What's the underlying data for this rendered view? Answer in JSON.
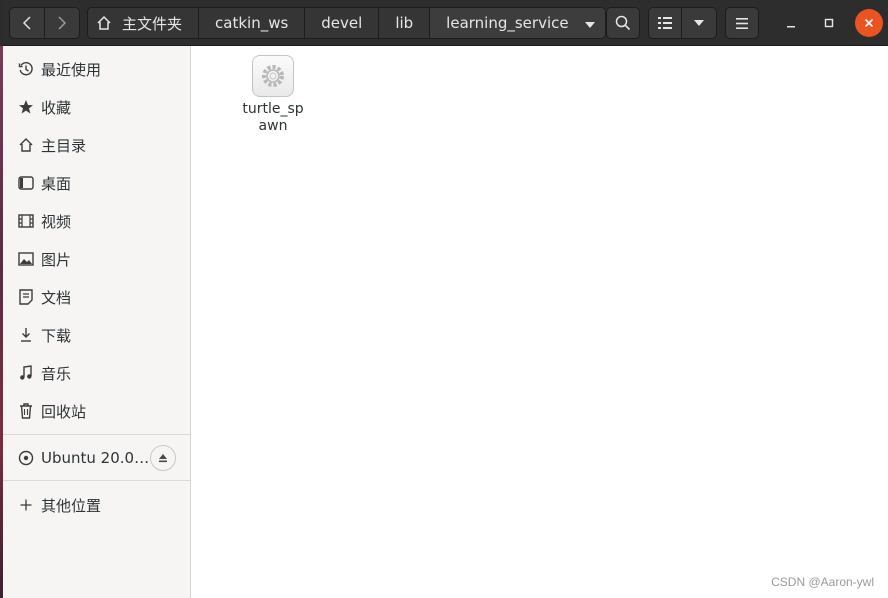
{
  "colors": {
    "accent_close": "#e95420",
    "headerbar_bg": "#2d2d2d",
    "sidebar_bg": "#f6f5f4",
    "content_bg": "#ffffff"
  },
  "header": {
    "back_icon": "chevron-left-icon",
    "forward_icon": "chevron-right-icon",
    "breadcrumbs": [
      "主文件夹",
      "catkin_ws",
      "devel",
      "lib",
      "learning_service"
    ],
    "search_icon": "search-icon",
    "view_icon": "list-view-icon",
    "view_menu_icon": "chevron-down-icon",
    "menu_icon": "hamburger-menu-icon"
  },
  "sidebar": {
    "items": [
      {
        "label": "最近使用",
        "icon": "clock-icon"
      },
      {
        "label": "收藏",
        "icon": "star-icon"
      },
      {
        "label": "主目录",
        "icon": "home-icon"
      },
      {
        "label": "桌面",
        "icon": "desktop-icon"
      },
      {
        "label": "视频",
        "icon": "video-icon"
      },
      {
        "label": "图片",
        "icon": "image-icon"
      },
      {
        "label": "文档",
        "icon": "document-icon"
      },
      {
        "label": "下载",
        "icon": "download-icon"
      },
      {
        "label": "音乐",
        "icon": "music-icon"
      },
      {
        "label": "回收站",
        "icon": "trash-icon"
      }
    ],
    "devices": [
      {
        "label": "Ubuntu 20.0…",
        "icon": "disc-icon",
        "action_icon": "eject-icon"
      }
    ],
    "other": {
      "label": "其他位置",
      "icon": "plus-icon"
    }
  },
  "main": {
    "files": [
      {
        "name": "turtle_spawn",
        "icon": "executable-gear-icon"
      }
    ]
  },
  "watermark": "CSDN @Aaron-ywl"
}
